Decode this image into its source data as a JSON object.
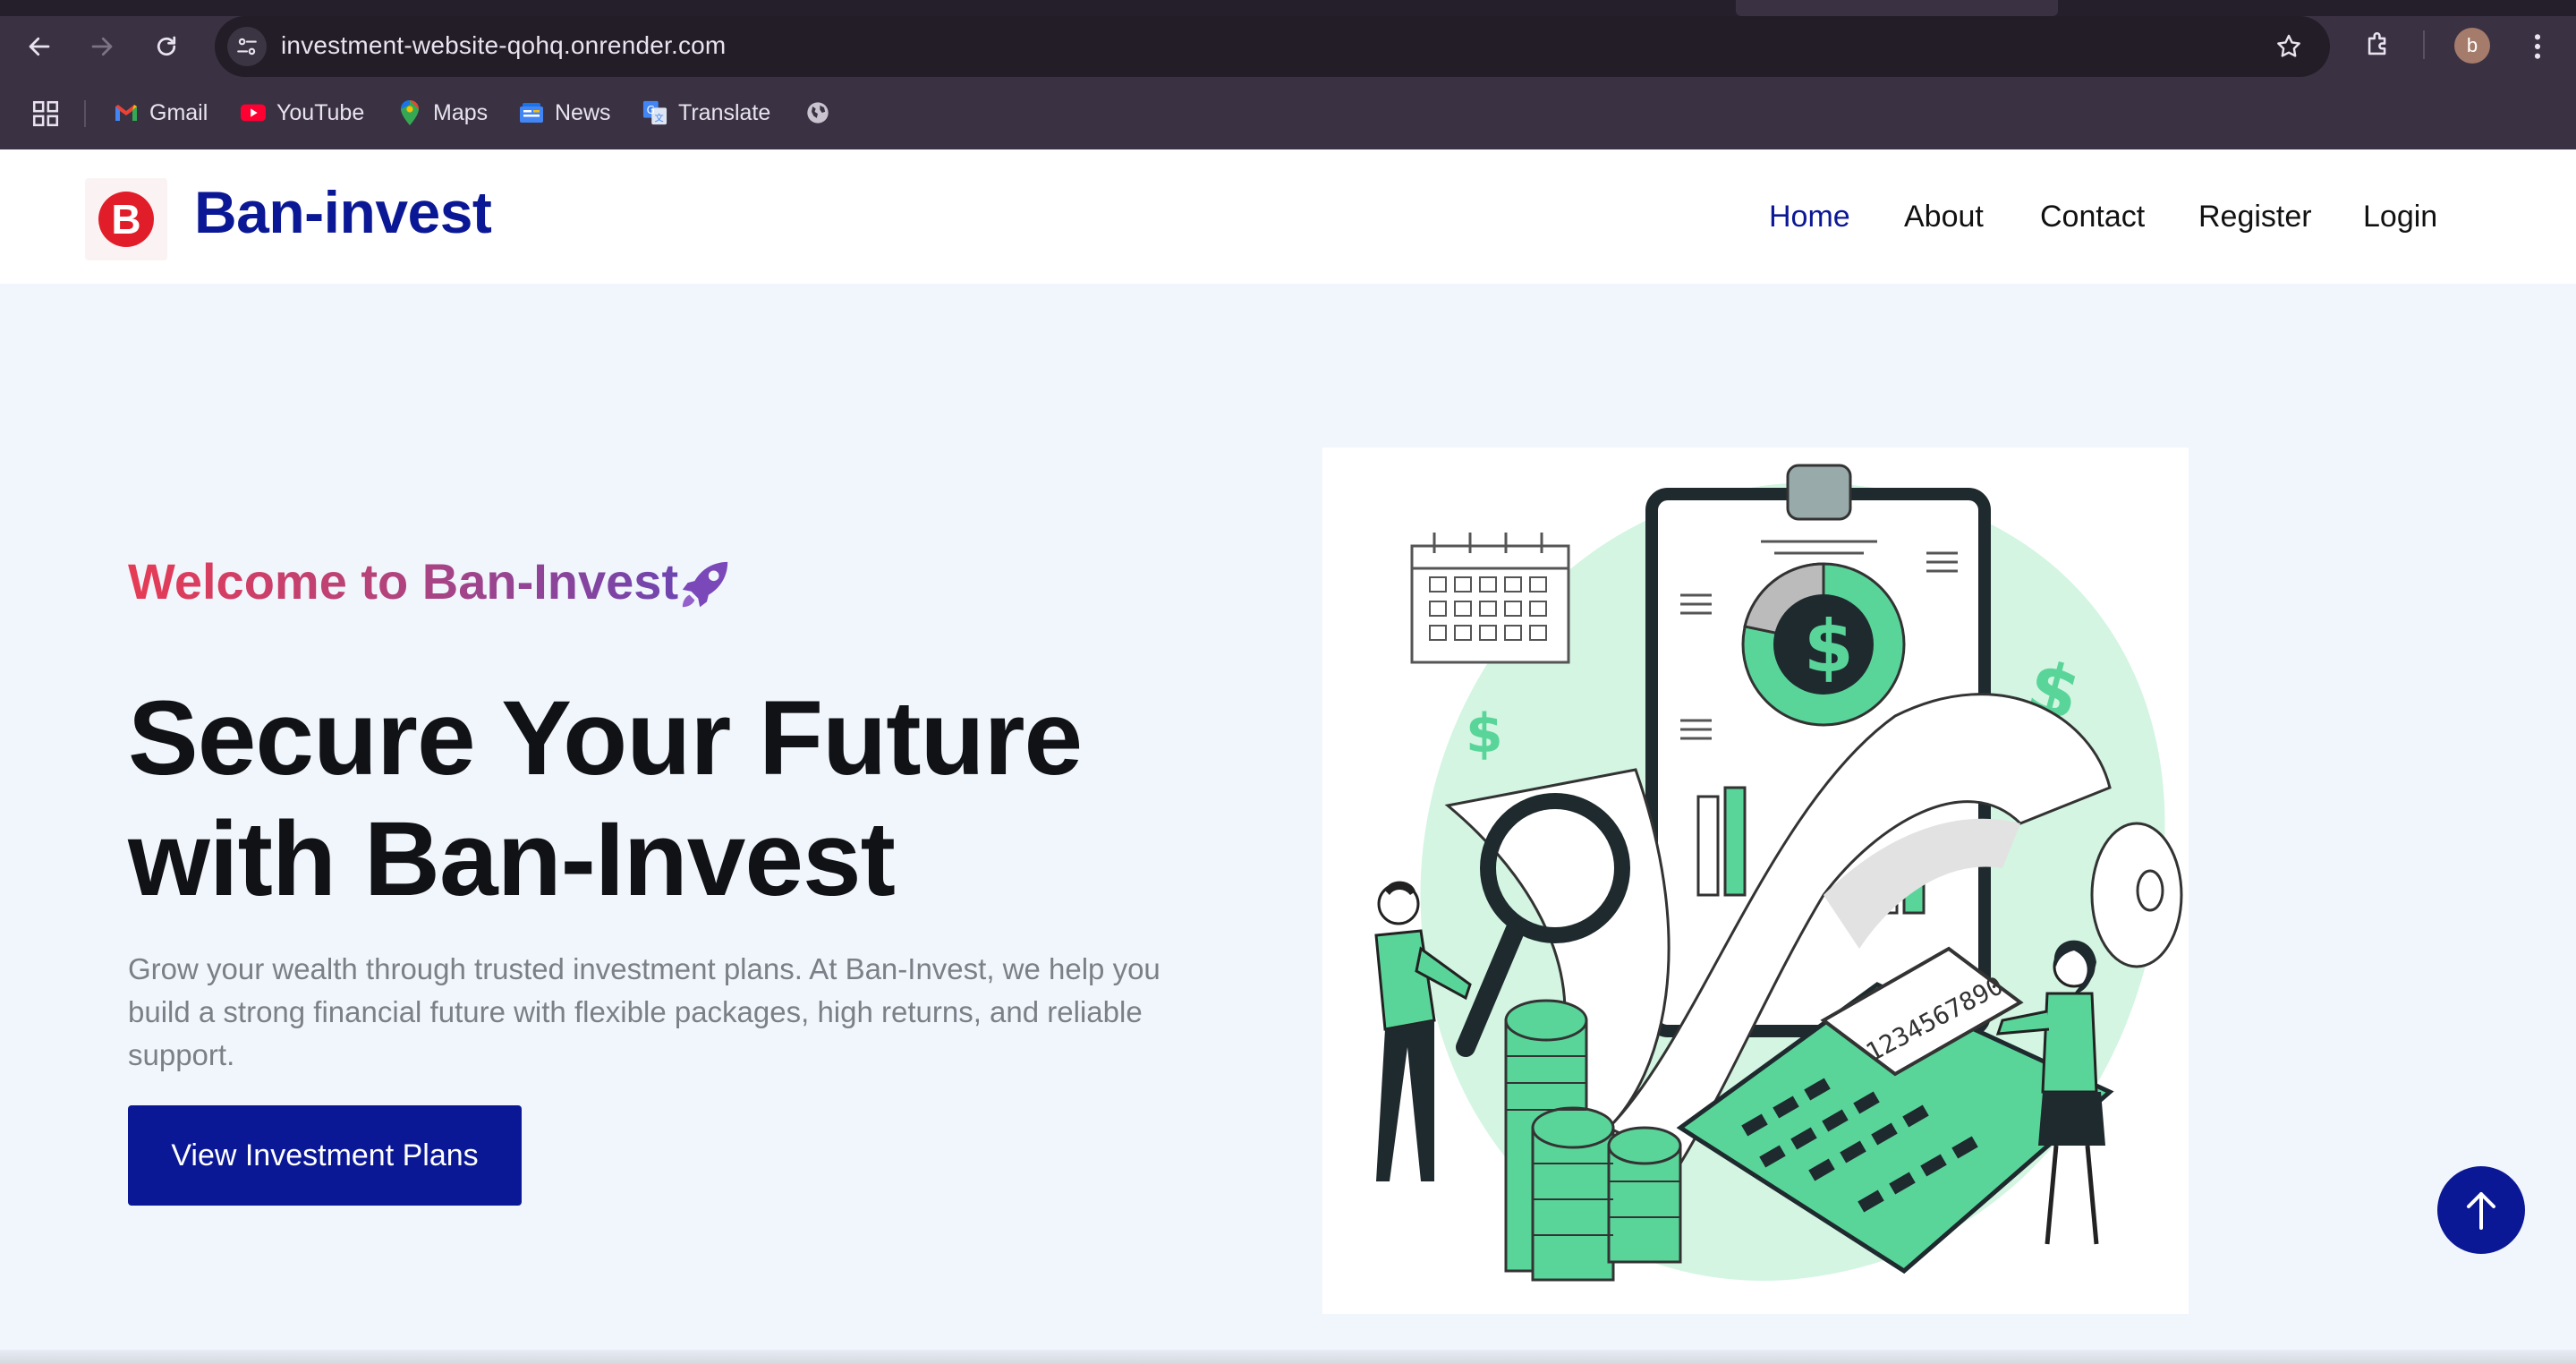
{
  "browser": {
    "url": "investment-website-qohq.onrender.com",
    "profile_initial": "b",
    "bookmarks": [
      {
        "label": "Gmail",
        "icon": "gmail-icon"
      },
      {
        "label": "YouTube",
        "icon": "youtube-icon"
      },
      {
        "label": "Maps",
        "icon": "maps-icon"
      },
      {
        "label": "News",
        "icon": "news-icon"
      },
      {
        "label": "Translate",
        "icon": "translate-icon"
      },
      {
        "label": "",
        "icon": "globe-icon"
      }
    ]
  },
  "site": {
    "logo_letter": "B",
    "brand": "Ban-invest",
    "nav": [
      "Home",
      "About",
      "Contact",
      "Register",
      "Login"
    ],
    "active_nav": "Home"
  },
  "hero": {
    "welcome": "Welcome to Ban-Invest",
    "title": "Secure Your Future with Ban-Invest",
    "description": "Grow your wealth through trusted investment plans. At Ban-Invest, we help you build a strong financial future with flexible packages, high returns, and reliable support.",
    "cta": "View Investment Plans",
    "calculator_display": "1234567890"
  },
  "colors": {
    "brand_blue": "#0b1895",
    "accent_green": "#5ad59a",
    "logo_red": "#e11d2a",
    "hero_bg": "#f1f6fd"
  }
}
